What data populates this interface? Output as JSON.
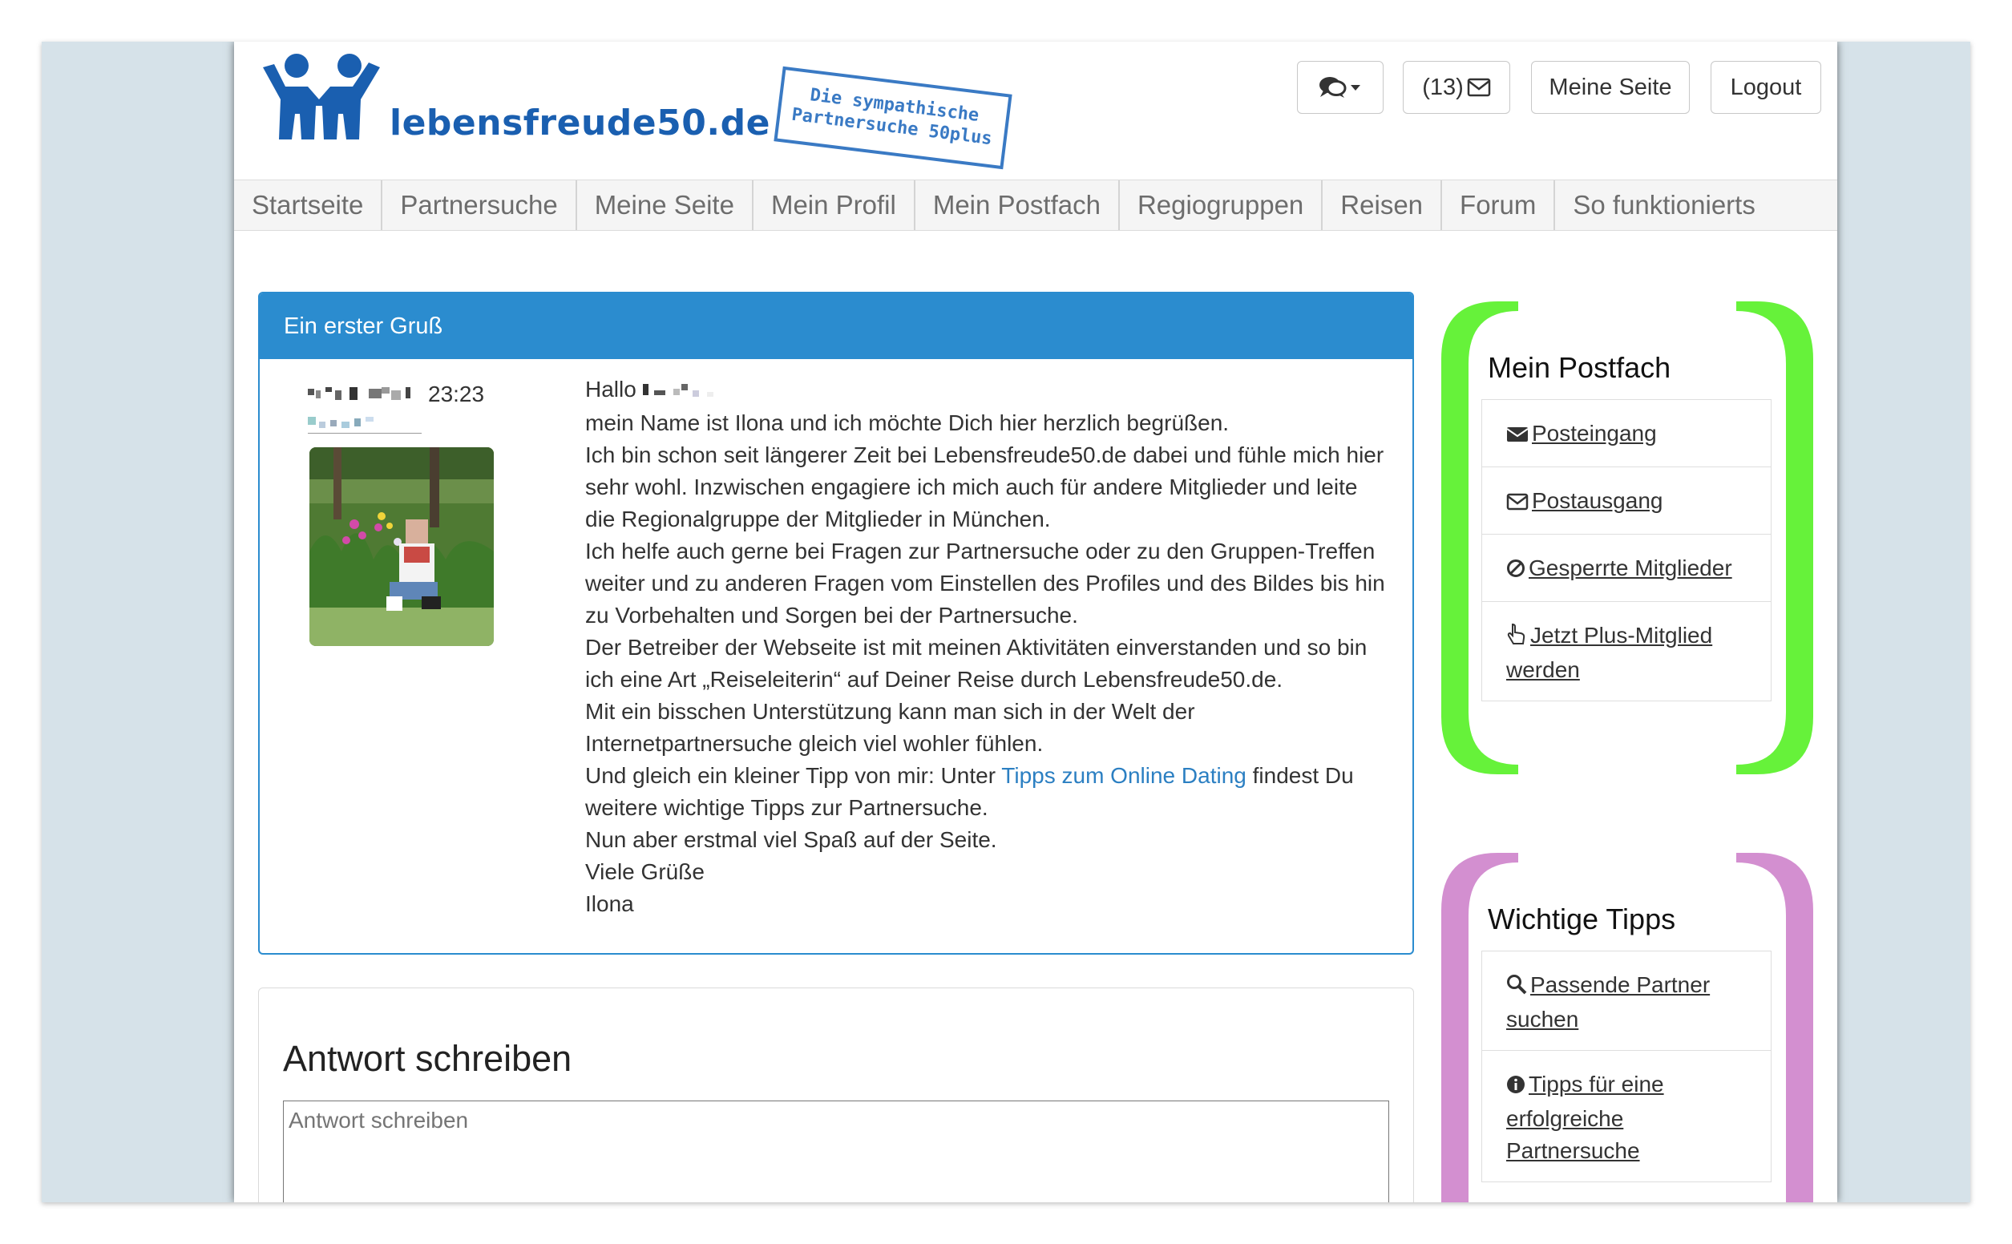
{
  "site": {
    "logo_text": "lebensfreude50.de",
    "stamp_line1": "Die sympathische",
    "stamp_line2": "Partnersuche 50plus"
  },
  "header_buttons": {
    "messages_count": "(13)",
    "my_page": "Meine Seite",
    "logout": "Logout"
  },
  "nav": {
    "items": [
      "Startseite",
      "Partnersuche",
      "Meine Seite",
      "Mein Profil",
      "Mein Postfach",
      "Regiogruppen",
      "Reisen",
      "Forum",
      "So funktionierts"
    ]
  },
  "message": {
    "title": "Ein erster Gruß",
    "time": "23:23",
    "greeting": "Hallo",
    "lines": [
      "mein Name ist Ilona und ich möchte Dich hier herzlich begrüßen.",
      "Ich bin schon seit längerer Zeit bei Lebensfreude50.de dabei und fühle mich hier sehr wohl. Inzwischen engagiere ich mich auch für andere Mitglieder und leite die Regionalgruppe der Mitglieder in München.",
      "Ich helfe auch gerne bei Fragen zur Partnersuche oder zu den Gruppen-Treffen weiter und zu anderen Fragen vom Einstellen des Profiles und des Bildes bis hin zu Vorbehalten und Sorgen bei der Partnersuche.",
      "Der Betreiber der Webseite ist mit meinen Aktivitäten einverstanden und so bin ich eine Art „Reiseleiterin“ auf Deiner Reise durch Lebensfreude50.de.",
      "Mit ein bisschen Unterstützung kann man sich in der Welt der Internetpartnersuche gleich viel wohler fühlen."
    ],
    "tip_prefix": "Und gleich ein kleiner Tipp von mir: Unter",
    "tip_link": "Tipps zum Online Dating",
    "tip_suffix": "findest Du weitere wichtige Tipps zur Partnersuche.",
    "closing": [
      "Nun aber erstmal viel Spaß auf der Seite.",
      "Viele Grüße",
      "Ilona"
    ]
  },
  "reply": {
    "title": "Antwort schreiben",
    "placeholder": "Antwort schreiben"
  },
  "postfach": {
    "title": "Mein Postfach",
    "color": "#66f23a",
    "items": [
      {
        "icon": "envelope-icon",
        "label": "Posteingang"
      },
      {
        "icon": "envelope-outline-icon",
        "label": "Postausgang"
      },
      {
        "icon": "ban-icon",
        "label": "Gesperrte Mitglieder"
      },
      {
        "icon": "hand-pointer-icon",
        "label": "Jetzt Plus-Mitglied werden"
      }
    ]
  },
  "tipps": {
    "title": "Wichtige Tipps",
    "color": "#d38fd0",
    "items": [
      {
        "icon": "search-icon",
        "label": "Passende Partner suchen"
      },
      {
        "icon": "info-circle-icon",
        "label": "Tipps für eine erfolgreiche Partnersuche"
      }
    ]
  },
  "colors": {
    "accent": "#2b8ccf",
    "logo": "#1a5fb0"
  }
}
